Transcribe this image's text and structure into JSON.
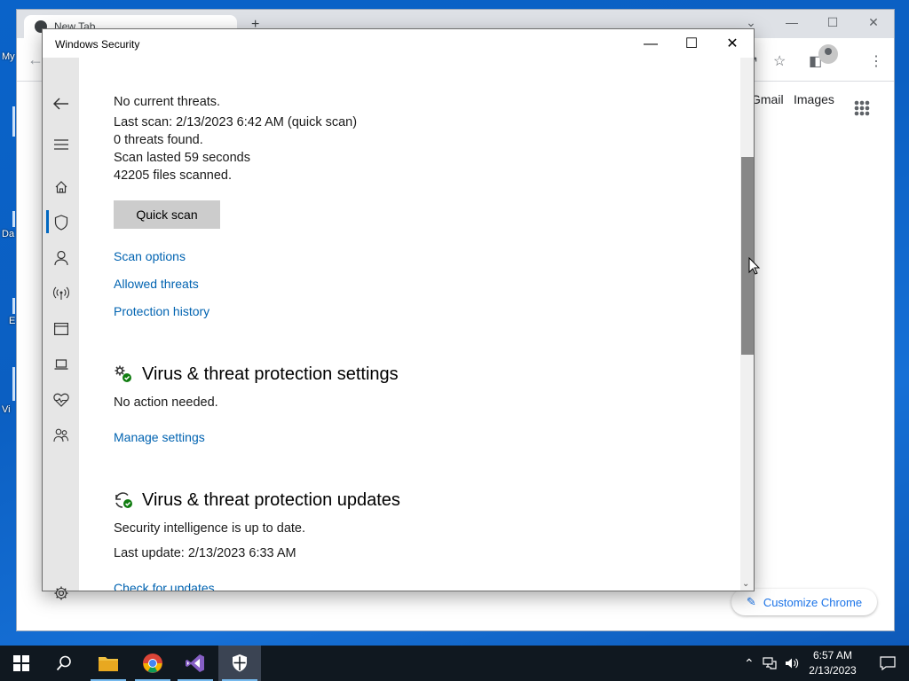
{
  "desktop": {
    "fragments": [
      "My",
      "Da",
      "E",
      "Vi"
    ]
  },
  "chrome": {
    "tab_title": "New Tab",
    "new_tab": "+",
    "links": {
      "gmail": "Gmail",
      "images": "Images"
    },
    "customize_label": "Customize Chrome"
  },
  "windows_security": {
    "title": "Windows Security",
    "status": {
      "no_threats": "No current threats.",
      "last_scan": "Last scan: 2/13/2023 6:42 AM (quick scan)",
      "threats_found": "0 threats found.",
      "scan_duration": "Scan lasted 59 seconds",
      "files_scanned": "42205 files scanned."
    },
    "quick_scan_label": "Quick scan",
    "links": {
      "scan_options": "Scan options",
      "allowed_threats": "Allowed threats",
      "protection_history": "Protection history"
    },
    "settings_section": {
      "heading": "Virus & threat protection settings",
      "status": "No action needed.",
      "link": "Manage settings"
    },
    "updates_section": {
      "heading": "Virus & threat protection updates",
      "status": "Security intelligence is up to date.",
      "last_update": "Last update: 2/13/2023 6:33 AM",
      "link": "Check for updates"
    },
    "nav_icons": [
      "back-arrow-icon",
      "hamburger-menu-icon",
      "home-icon",
      "shield-icon",
      "person-icon",
      "wireless-icon",
      "app-browser-icon",
      "laptop-icon",
      "heart-health-icon",
      "family-icon",
      "settings-gear-icon"
    ],
    "accent": "#0063b1"
  },
  "taskbar": {
    "clock_time": "6:57 AM",
    "clock_date": "2/13/2023",
    "apps": [
      "start",
      "search",
      "file-explorer",
      "chrome",
      "visual-studio",
      "windows-security"
    ]
  }
}
